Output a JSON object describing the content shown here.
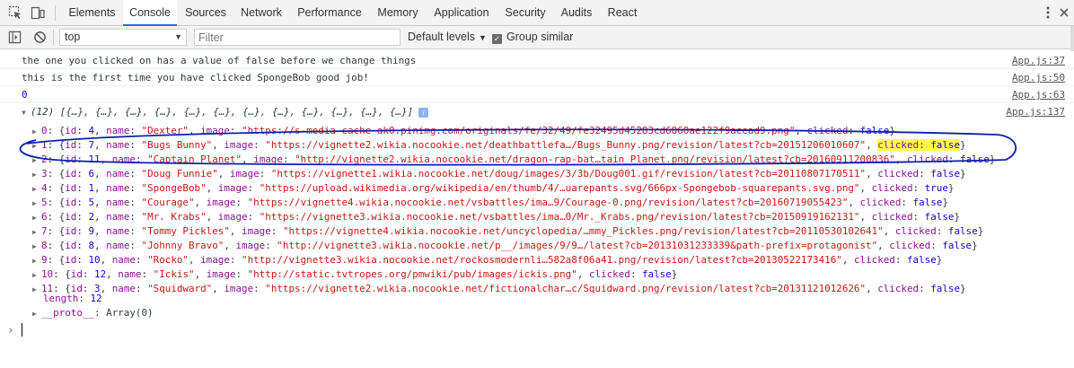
{
  "tabs": [
    "Elements",
    "Console",
    "Sources",
    "Network",
    "Performance",
    "Memory",
    "Application",
    "Security",
    "Audits",
    "React"
  ],
  "active_tab": "Console",
  "toolbar": {
    "context": "top",
    "filter_placeholder": "Filter",
    "levels": "Default levels",
    "group_similar": "Group similar"
  },
  "logs": [
    {
      "text": "the one you clicked on has a value of false before we change things",
      "source": "App.js:37"
    },
    {
      "text": "this is the first time you have clicked SpongeBob good job!",
      "source": "App.js:50"
    },
    {
      "text": "0",
      "source": "App.js:63"
    },
    {
      "text": "(12) [{…}, {…}, {…}, {…}, {…}, {…}, {…}, {…}, {…}, {…}, {…}, {…}]",
      "source": "App.js:137"
    }
  ],
  "array_items": [
    {
      "index": "0",
      "id": "4",
      "name": "\"Dexter\"",
      "image": "\"https://s-media-cache-ak0.pinimg.com/originals/fe/32/49/fe32495d45283cd6860ae122f9aeead9.png\"",
      "clicked": "false"
    },
    {
      "index": "1",
      "id": "7",
      "name": "\"Bugs Bunny\"",
      "image": "\"https://vignette2.wikia.nocookie.net/deathbattlefa…/Bugs_Bunny.png/revision/latest?cb=20151206010607\"",
      "clicked": "false"
    },
    {
      "index": "2",
      "id": "11",
      "name": "\"Captain Planet\"",
      "image": "\"http://vignette2.wikia.nocookie.net/dragon-rap-bat…tain_Planet.png/revision/latest?cb=20160911200836\"",
      "clicked": "false"
    },
    {
      "index": "3",
      "id": "6",
      "name": "\"Doug Funnie\"",
      "image": "\"https://vignette1.wikia.nocookie.net/doug/images/3/3b/Doug001.gif/revision/latest?cb=20110807170511\"",
      "clicked": "false"
    },
    {
      "index": "4",
      "id": "1",
      "name": "\"SpongeBob\"",
      "image": "\"https://upload.wikimedia.org/wikipedia/en/thumb/4/…uarepants.svg/666px-Spongebob-squarepants.svg.png\"",
      "clicked": "true"
    },
    {
      "index": "5",
      "id": "5",
      "name": "\"Courage\"",
      "image": "\"https://vignette4.wikia.nocookie.net/vsbattles/ima…9/Courage-0.png/revision/latest?cb=20160719055423\"",
      "clicked": "false"
    },
    {
      "index": "6",
      "id": "2",
      "name": "\"Mr. Krabs\"",
      "image": "\"https://vignette3.wikia.nocookie.net/vsbattles/ima…0/Mr._Krabs.png/revision/latest?cb=20150919162131\"",
      "clicked": "false"
    },
    {
      "index": "7",
      "id": "9",
      "name": "\"Tommy Pickles\"",
      "image": "\"https://vignette4.wikia.nocookie.net/uncyclopedia/…mmy_Pickles.png/revision/latest?cb=20110530102641\"",
      "clicked": "false"
    },
    {
      "index": "8",
      "id": "8",
      "name": "\"Johnny Bravo\"",
      "image": "\"http://vignette3.wikia.nocookie.net/p__/images/9/9…/latest?cb=20131031233339&path-prefix=protagonist\"",
      "clicked": "false"
    },
    {
      "index": "9",
      "id": "10",
      "name": "\"Rocko\"",
      "image": "\"http://vignette3.wikia.nocookie.net/rockosmodernli…582a8f06a41.png/revision/latest?cb=20130522173416\"",
      "clicked": "false"
    },
    {
      "index": "10",
      "id": "12",
      "name": "\"Ickis\"",
      "image": "\"http://static.tvtropes.org/pmwiki/pub/images/ickis.png\"",
      "clicked": "false"
    },
    {
      "index": "11",
      "id": "3",
      "name": "\"Squidward\"",
      "image": "\"https://vignette2.wikia.nocookie.net/fictionalchar…c/Squidward.png/revision/latest?cb=20131121012626\"",
      "clicked": "false"
    }
  ],
  "length_label": "length",
  "length_value": "12",
  "proto_label": "__proto__",
  "proto_value": "Array(0)",
  "prompt_symbol": "›"
}
